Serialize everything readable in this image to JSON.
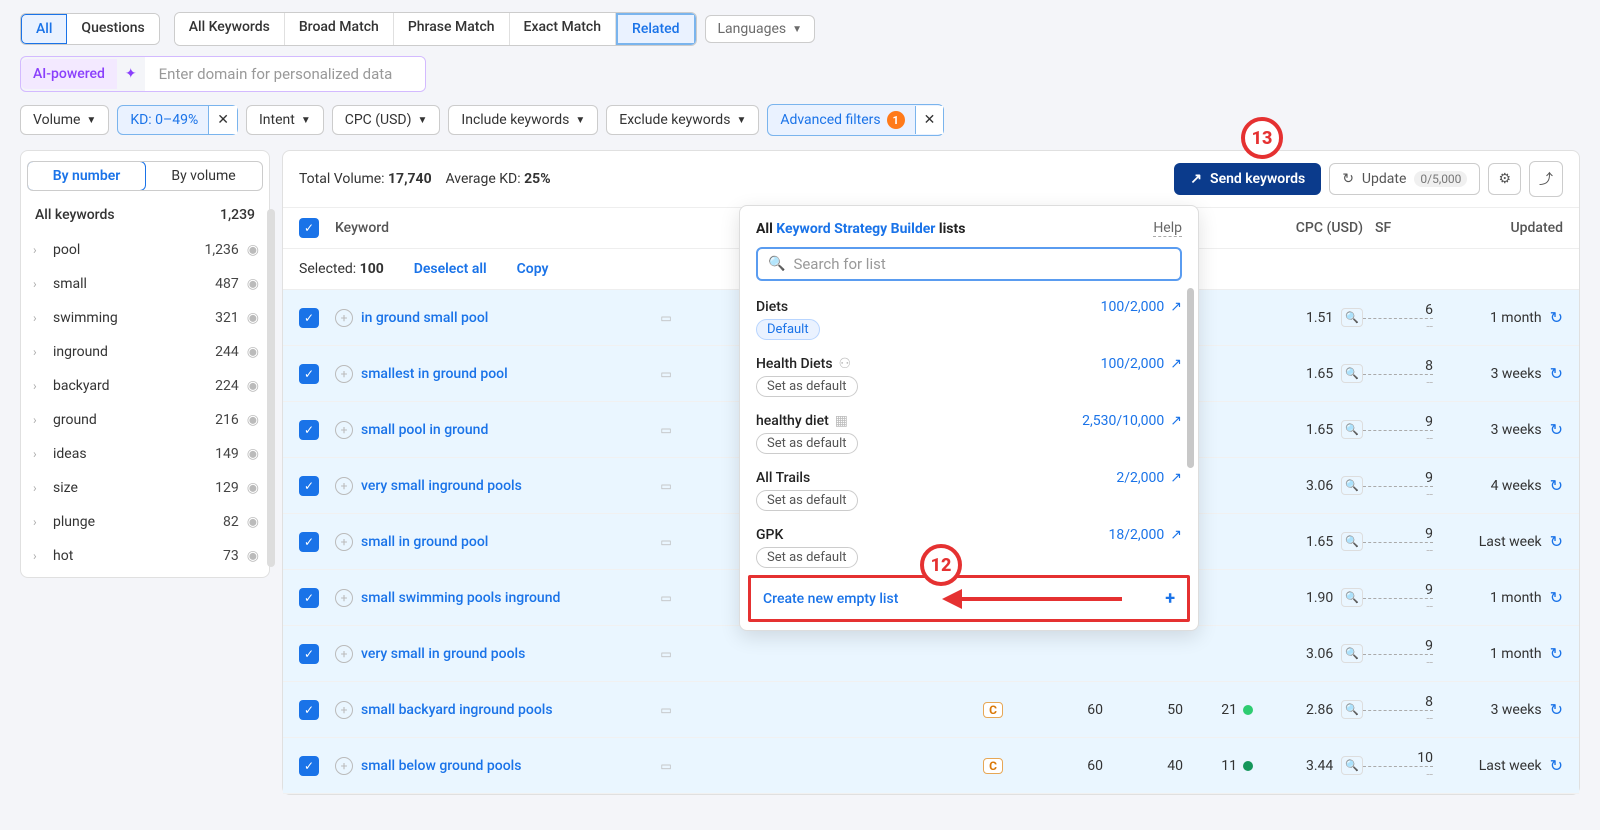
{
  "tabs": {
    "all": "All",
    "questions": "Questions",
    "all_keywords": "All Keywords",
    "broad": "Broad Match",
    "phrase": "Phrase Match",
    "exact": "Exact Match",
    "related": "Related",
    "languages": "Languages"
  },
  "ai": {
    "badge": "AI-powered",
    "placeholder": "Enter domain for personalized data"
  },
  "filters": {
    "volume": "Volume",
    "kd": "KD: 0–49%",
    "intent": "Intent",
    "cpc": "CPC (USD)",
    "include": "Include keywords",
    "exclude": "Exclude keywords",
    "advanced": "Advanced filters",
    "adv_count": "1"
  },
  "sidebar": {
    "by_number": "By number",
    "by_volume": "By volume",
    "header": "All keywords",
    "header_count": "1,239",
    "items": [
      {
        "label": "pool",
        "count": "1,236"
      },
      {
        "label": "small",
        "count": "487"
      },
      {
        "label": "swimming",
        "count": "321"
      },
      {
        "label": "inground",
        "count": "244"
      },
      {
        "label": "backyard",
        "count": "224"
      },
      {
        "label": "ground",
        "count": "216"
      },
      {
        "label": "ideas",
        "count": "149"
      },
      {
        "label": "size",
        "count": "129"
      },
      {
        "label": "plunge",
        "count": "82"
      },
      {
        "label": "hot",
        "count": "73"
      }
    ]
  },
  "summary": {
    "total_label": "Total Volume:",
    "total": "17,740",
    "avg_label": "Average KD:",
    "avg": "25%"
  },
  "actions": {
    "send": "Send keywords",
    "update": "Update",
    "update_count": "0/5,000"
  },
  "table": {
    "h_keyword": "Keyword",
    "h_cpc": "CPC (USD)",
    "h_sf": "SF",
    "h_updated": "Updated",
    "selected": "Selected:",
    "sel_count": "100",
    "deselect": "Deselect all",
    "copy": "Copy",
    "rows": [
      {
        "kw": "in ground small pool",
        "cpc": "1.51",
        "sf": "6",
        "updated": "1 month"
      },
      {
        "kw": "smallest in ground pool",
        "cpc": "1.65",
        "sf": "8",
        "updated": "3 weeks"
      },
      {
        "kw": "small pool in ground",
        "cpc": "1.65",
        "sf": "9",
        "updated": "3 weeks"
      },
      {
        "kw": "very small inground pools",
        "cpc": "3.06",
        "sf": "9",
        "updated": "4 weeks"
      },
      {
        "kw": "small in ground pool",
        "cpc": "1.65",
        "sf": "9",
        "updated": "Last week"
      },
      {
        "kw": "small swimming pools inground",
        "cpc": "1.90",
        "sf": "9",
        "updated": "1 month"
      },
      {
        "kw": "very small in ground pools",
        "cpc": "3.06",
        "sf": "9",
        "updated": "1 month"
      },
      {
        "kw": "small backyard inground pools",
        "intent": "C",
        "vol": "60",
        "kd": "50",
        "kdn": "21",
        "dot": "g",
        "cpc": "2.86",
        "sf": "8",
        "updated": "3 weeks"
      },
      {
        "kw": "small below ground pools",
        "intent": "C",
        "vol": "60",
        "kd": "40",
        "kdn": "11",
        "dot": "dg",
        "cpc": "3.44",
        "sf": "10",
        "updated": "Last week"
      }
    ]
  },
  "popup": {
    "title_prefix": "All ",
    "title_link": "Keyword Strategy Builder",
    "title_suffix": " lists",
    "help": "Help",
    "search_placeholder": "Search for list",
    "lists": [
      {
        "name": "Diets",
        "badge": "Default",
        "badge_style": "blue",
        "count": "100/2,000"
      },
      {
        "name": "Health Diets",
        "badge": "Set as default",
        "badge_style": "gray",
        "count": "100/2,000",
        "icon": "share"
      },
      {
        "name": "healthy diet",
        "badge": "Set as default",
        "badge_style": "gray",
        "count": "2,530/10,000",
        "icon": "grid"
      },
      {
        "name": "All Trails",
        "badge": "Set as default",
        "badge_style": "gray",
        "count": "2/2,000"
      },
      {
        "name": "GPK",
        "badge": "Set as default",
        "badge_style": "gray",
        "count": "18/2,000"
      }
    ],
    "create": "Create new empty list"
  },
  "annotations": {
    "twelve": "12",
    "thirteen": "13"
  }
}
